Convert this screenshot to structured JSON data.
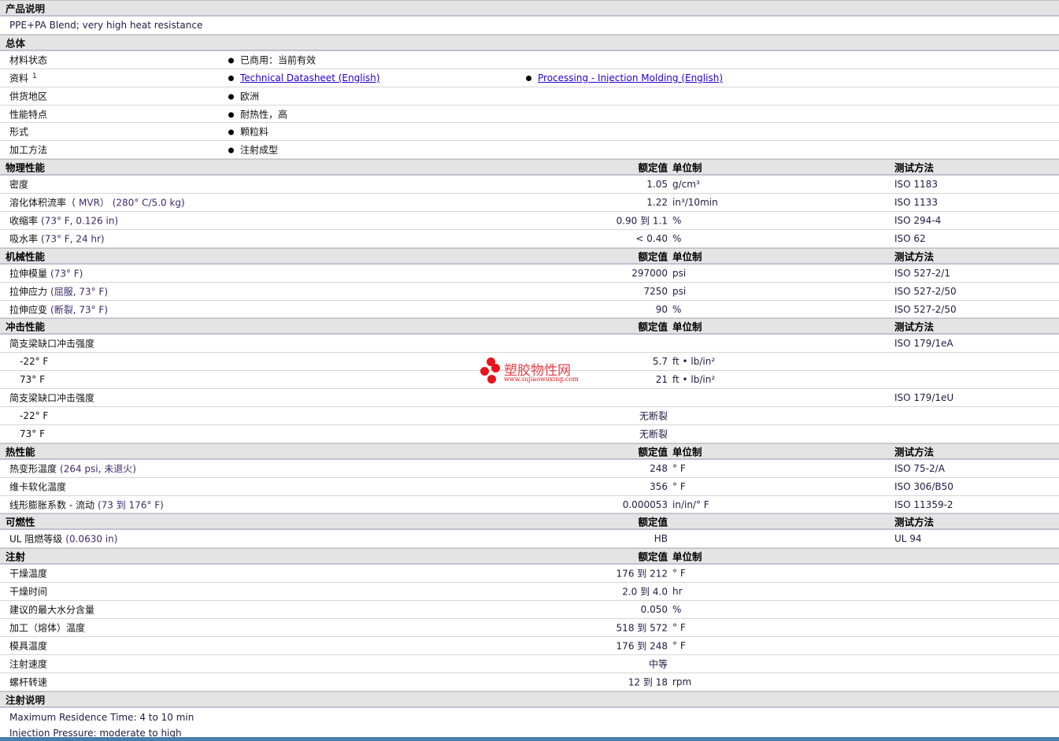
{
  "description": {
    "header": "产品说明",
    "text": "PPE+PA Blend; very high heat resistance"
  },
  "general": {
    "header": "总体",
    "rows": [
      {
        "label": "材料状态",
        "items": [
          {
            "text": "已商用：当前有效"
          }
        ]
      },
      {
        "label": "资料",
        "sup": "1",
        "items": [
          {
            "text": "Technical Datasheet (English)",
            "link": true
          },
          {
            "text": "Processing - Injection Molding (English)",
            "link": true
          }
        ]
      },
      {
        "label": "供货地区",
        "items": [
          {
            "text": "欧洲"
          }
        ]
      },
      {
        "label": "性能特点",
        "items": [
          {
            "text": "耐热性，高"
          }
        ]
      },
      {
        "label": "形式",
        "items": [
          {
            "text": "颗粒料"
          }
        ]
      },
      {
        "label": "加工方法",
        "items": [
          {
            "text": "注射成型"
          }
        ]
      }
    ]
  },
  "sections": [
    {
      "header": "物理性能",
      "value_h": "额定值",
      "unit_h": "单位制",
      "test_h": "测试方法",
      "rows": [
        {
          "label": "密度",
          "cond": "",
          "value": "1.05",
          "unit": "g/cm³",
          "test": "ISO 1183"
        },
        {
          "label": "溶化体积流率（",
          "cond": "MVR） (280° C/5.0 kg)",
          "value": "1.22",
          "unit": "in³/10min",
          "test": "ISO 1133"
        },
        {
          "label": "收缩率",
          "cond": "(73° F, 0.126 in)",
          "value": "0.90 到  1.1",
          "unit": "%",
          "test": "ISO 294-4"
        },
        {
          "label": "吸水率",
          "cond": "(73° F, 24 hr)",
          "value": "< 0.40",
          "unit": "%",
          "test": "ISO 62"
        }
      ]
    },
    {
      "header": "机械性能",
      "value_h": "额定值",
      "unit_h": "单位制",
      "test_h": "测试方法",
      "rows": [
        {
          "label": "拉伸模量",
          "cond": "(73° F)",
          "value": "297000",
          "unit": "psi",
          "test": "ISO 527-2/1"
        },
        {
          "label": "拉伸应力",
          "cond": "(屈服, 73° F)",
          "value": "7250",
          "unit": "psi",
          "test": "ISO 527-2/50"
        },
        {
          "label": "拉伸应变",
          "cond": "(断裂, 73° F)",
          "value": "90",
          "unit": "%",
          "test": "ISO 527-2/50"
        }
      ]
    },
    {
      "header": "冲击性能",
      "value_h": "额定值",
      "unit_h": "单位制",
      "test_h": "测试方法",
      "rows": [
        {
          "label": "简支梁缺口冲击强度",
          "cond": "",
          "value": "",
          "unit": "",
          "test": "ISO 179/1eA"
        },
        {
          "label": "-22° F",
          "indent": true,
          "cond": "",
          "value": "5.7",
          "unit": "ft • lb/in²",
          "test": ""
        },
        {
          "label": "73° F",
          "indent": true,
          "cond": "",
          "value": "21",
          "unit": "ft • lb/in²",
          "test": ""
        },
        {
          "label": "简支梁缺口冲击强度",
          "cond": "",
          "value": "",
          "unit": "",
          "test": "ISO 179/1eU"
        },
        {
          "label": "-22° F",
          "indent": true,
          "cond": "",
          "value": "无断裂",
          "unit": "",
          "test": ""
        },
        {
          "label": "73° F",
          "indent": true,
          "cond": "",
          "value": "无断裂",
          "unit": "",
          "test": ""
        }
      ]
    },
    {
      "header": "热性能",
      "value_h": "额定值",
      "unit_h": "单位制",
      "test_h": "测试方法",
      "rows": [
        {
          "label": "热变形温度",
          "cond": "(264 psi, 未退火)",
          "value": "248",
          "unit": "° F",
          "test": "ISO 75-2/A"
        },
        {
          "label": "维卡软化温度",
          "cond": "",
          "value": "356",
          "unit": "° F",
          "test": "ISO 306/B50"
        },
        {
          "label": "线形膨胀系数 - 流动",
          "cond": "(73 到  176° F)",
          "value": "0.000053",
          "unit": "in/in/° F",
          "test": "ISO 11359-2"
        }
      ]
    },
    {
      "header": "可燃性",
      "value_h": "额定值",
      "unit_h": "",
      "test_h": "测试方法",
      "rows": [
        {
          "label": "UL 阻燃等级",
          "cond": "(0.0630 in)",
          "value": "HB",
          "unit": "",
          "test": "UL 94"
        }
      ]
    },
    {
      "header": "注射",
      "value_h": "额定值",
      "unit_h": "单位制",
      "test_h": "",
      "rows": [
        {
          "label": "干燥温度",
          "cond": "",
          "value": "176 到  212",
          "unit": "° F",
          "test": ""
        },
        {
          "label": "干燥时间",
          "cond": "",
          "value": "2.0 到  4.0",
          "unit": "hr",
          "test": ""
        },
        {
          "label": "建议的最大水分含量",
          "cond": "",
          "value": "0.050",
          "unit": "%",
          "test": ""
        },
        {
          "label": "加工（熔体）温度",
          "cond": "",
          "value": "518 到  572",
          "unit": "° F",
          "test": ""
        },
        {
          "label": "模具温度",
          "cond": "",
          "value": "176 到  248",
          "unit": "° F",
          "test": ""
        },
        {
          "label": "注射速度",
          "cond": "",
          "value": "中等",
          "unit": "",
          "test": ""
        },
        {
          "label": "螺杆转速",
          "cond": "",
          "value": "12 到  18",
          "unit": "rpm",
          "test": ""
        }
      ]
    }
  ],
  "injection_notes": {
    "header": "注射说明",
    "lines": [
      "Maximum Residence Time: 4 to 10 min",
      "Injection Pressure: moderate to high"
    ]
  },
  "watermark": {
    "name": "塑胶物性网",
    "url": "www.sujiaowuxing.com"
  },
  "colors": {
    "header_bg": "#e4e4e4",
    "link": "#2200cc",
    "footer": "#4a7fad",
    "watermark": "#e8141c"
  }
}
